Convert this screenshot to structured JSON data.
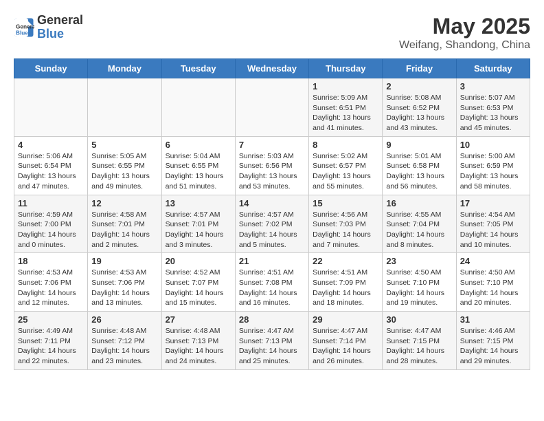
{
  "header": {
    "logo": {
      "line1": "General",
      "line2": "Blue"
    },
    "title": "May 2025",
    "location": "Weifang, Shandong, China"
  },
  "calendar": {
    "days_of_week": [
      "Sunday",
      "Monday",
      "Tuesday",
      "Wednesday",
      "Thursday",
      "Friday",
      "Saturday"
    ],
    "weeks": [
      {
        "row_bg": "odd",
        "days": [
          {
            "num": "",
            "info": "",
            "empty": true
          },
          {
            "num": "",
            "info": "",
            "empty": true
          },
          {
            "num": "",
            "info": "",
            "empty": true
          },
          {
            "num": "",
            "info": "",
            "empty": true
          },
          {
            "num": "1",
            "info": "Sunrise: 5:09 AM\nSunset: 6:51 PM\nDaylight: 13 hours\nand 41 minutes.",
            "empty": false
          },
          {
            "num": "2",
            "info": "Sunrise: 5:08 AM\nSunset: 6:52 PM\nDaylight: 13 hours\nand 43 minutes.",
            "empty": false
          },
          {
            "num": "3",
            "info": "Sunrise: 5:07 AM\nSunset: 6:53 PM\nDaylight: 13 hours\nand 45 minutes.",
            "empty": false
          }
        ]
      },
      {
        "row_bg": "even",
        "days": [
          {
            "num": "4",
            "info": "Sunrise: 5:06 AM\nSunset: 6:54 PM\nDaylight: 13 hours\nand 47 minutes.",
            "empty": false
          },
          {
            "num": "5",
            "info": "Sunrise: 5:05 AM\nSunset: 6:55 PM\nDaylight: 13 hours\nand 49 minutes.",
            "empty": false
          },
          {
            "num": "6",
            "info": "Sunrise: 5:04 AM\nSunset: 6:55 PM\nDaylight: 13 hours\nand 51 minutes.",
            "empty": false
          },
          {
            "num": "7",
            "info": "Sunrise: 5:03 AM\nSunset: 6:56 PM\nDaylight: 13 hours\nand 53 minutes.",
            "empty": false
          },
          {
            "num": "8",
            "info": "Sunrise: 5:02 AM\nSunset: 6:57 PM\nDaylight: 13 hours\nand 55 minutes.",
            "empty": false
          },
          {
            "num": "9",
            "info": "Sunrise: 5:01 AM\nSunset: 6:58 PM\nDaylight: 13 hours\nand 56 minutes.",
            "empty": false
          },
          {
            "num": "10",
            "info": "Sunrise: 5:00 AM\nSunset: 6:59 PM\nDaylight: 13 hours\nand 58 minutes.",
            "empty": false
          }
        ]
      },
      {
        "row_bg": "odd",
        "days": [
          {
            "num": "11",
            "info": "Sunrise: 4:59 AM\nSunset: 7:00 PM\nDaylight: 14 hours\nand 0 minutes.",
            "empty": false
          },
          {
            "num": "12",
            "info": "Sunrise: 4:58 AM\nSunset: 7:01 PM\nDaylight: 14 hours\nand 2 minutes.",
            "empty": false
          },
          {
            "num": "13",
            "info": "Sunrise: 4:57 AM\nSunset: 7:01 PM\nDaylight: 14 hours\nand 3 minutes.",
            "empty": false
          },
          {
            "num": "14",
            "info": "Sunrise: 4:57 AM\nSunset: 7:02 PM\nDaylight: 14 hours\nand 5 minutes.",
            "empty": false
          },
          {
            "num": "15",
            "info": "Sunrise: 4:56 AM\nSunset: 7:03 PM\nDaylight: 14 hours\nand 7 minutes.",
            "empty": false
          },
          {
            "num": "16",
            "info": "Sunrise: 4:55 AM\nSunset: 7:04 PM\nDaylight: 14 hours\nand 8 minutes.",
            "empty": false
          },
          {
            "num": "17",
            "info": "Sunrise: 4:54 AM\nSunset: 7:05 PM\nDaylight: 14 hours\nand 10 minutes.",
            "empty": false
          }
        ]
      },
      {
        "row_bg": "even",
        "days": [
          {
            "num": "18",
            "info": "Sunrise: 4:53 AM\nSunset: 7:06 PM\nDaylight: 14 hours\nand 12 minutes.",
            "empty": false
          },
          {
            "num": "19",
            "info": "Sunrise: 4:53 AM\nSunset: 7:06 PM\nDaylight: 14 hours\nand 13 minutes.",
            "empty": false
          },
          {
            "num": "20",
            "info": "Sunrise: 4:52 AM\nSunset: 7:07 PM\nDaylight: 14 hours\nand 15 minutes.",
            "empty": false
          },
          {
            "num": "21",
            "info": "Sunrise: 4:51 AM\nSunset: 7:08 PM\nDaylight: 14 hours\nand 16 minutes.",
            "empty": false
          },
          {
            "num": "22",
            "info": "Sunrise: 4:51 AM\nSunset: 7:09 PM\nDaylight: 14 hours\nand 18 minutes.",
            "empty": false
          },
          {
            "num": "23",
            "info": "Sunrise: 4:50 AM\nSunset: 7:10 PM\nDaylight: 14 hours\nand 19 minutes.",
            "empty": false
          },
          {
            "num": "24",
            "info": "Sunrise: 4:50 AM\nSunset: 7:10 PM\nDaylight: 14 hours\nand 20 minutes.",
            "empty": false
          }
        ]
      },
      {
        "row_bg": "odd",
        "days": [
          {
            "num": "25",
            "info": "Sunrise: 4:49 AM\nSunset: 7:11 PM\nDaylight: 14 hours\nand 22 minutes.",
            "empty": false
          },
          {
            "num": "26",
            "info": "Sunrise: 4:48 AM\nSunset: 7:12 PM\nDaylight: 14 hours\nand 23 minutes.",
            "empty": false
          },
          {
            "num": "27",
            "info": "Sunrise: 4:48 AM\nSunset: 7:13 PM\nDaylight: 14 hours\nand 24 minutes.",
            "empty": false
          },
          {
            "num": "28",
            "info": "Sunrise: 4:47 AM\nSunset: 7:13 PM\nDaylight: 14 hours\nand 25 minutes.",
            "empty": false
          },
          {
            "num": "29",
            "info": "Sunrise: 4:47 AM\nSunset: 7:14 PM\nDaylight: 14 hours\nand 26 minutes.",
            "empty": false
          },
          {
            "num": "30",
            "info": "Sunrise: 4:47 AM\nSunset: 7:15 PM\nDaylight: 14 hours\nand 28 minutes.",
            "empty": false
          },
          {
            "num": "31",
            "info": "Sunrise: 4:46 AM\nSunset: 7:15 PM\nDaylight: 14 hours\nand 29 minutes.",
            "empty": false
          }
        ]
      }
    ]
  }
}
